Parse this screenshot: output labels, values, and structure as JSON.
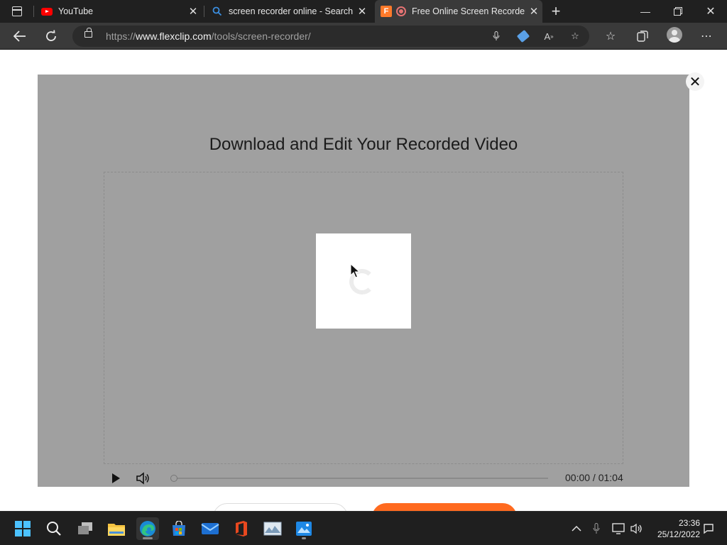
{
  "browser": {
    "tabs": [
      {
        "title": "YouTube",
        "favicon": "youtube-icon"
      },
      {
        "title": "screen recorder online - Search",
        "favicon": "search-icon"
      },
      {
        "title": "Free Online Screen Recorder",
        "favicon": "flexclip-icon",
        "active": true
      }
    ],
    "address": {
      "scheme": "https://",
      "host": "www.flexclip.com",
      "path": "/tools/screen-recorder/"
    }
  },
  "modal": {
    "title": "Download and Edit Your Recorded Video",
    "player": {
      "time": "00:00 / 01:04",
      "progress": 0
    }
  },
  "taskbar": {
    "apps": [
      "start-icon",
      "search-icon",
      "task-view-icon",
      "file-explorer-icon",
      "edge-icon",
      "store-icon",
      "mail-icon",
      "office-icon",
      "photos-icon",
      "image-viewer-icon"
    ],
    "clock": {
      "time": "23:36",
      "date": "25/12/2022"
    }
  },
  "colors": {
    "accent": "#ff6a1f",
    "overlay": "#a0a0a0",
    "taskbar": "#1f1f1f"
  }
}
